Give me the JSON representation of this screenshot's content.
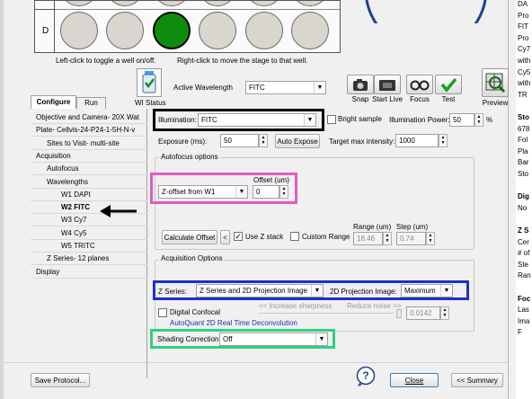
{
  "plate": {
    "row_label": "D"
  },
  "hint": {
    "left": "Left-click to toggle a well on/off.",
    "right": "Right-click to move the stage to that well."
  },
  "toolbar": {
    "wi_status": "WI Status",
    "active_wavelength_label": "Active Wavelength",
    "active_wavelength": "FITC",
    "snap": "Snap",
    "start_live": "Start Live",
    "focus": "Focus",
    "test": "Test",
    "preview": "Preview"
  },
  "tabs": {
    "configure": "Configure",
    "run": "Run"
  },
  "nav": {
    "items": [
      "Objective and Camera- 20X Wat",
      "Plate- Cellvis-24-P24-1-5H-N-v",
      "Sites to Visit- multi-site",
      "Acquisition",
      "Autofocus",
      "Wavelengths",
      "W1 DAPI",
      "W2 FITC",
      "W3 Cy7",
      "W4 Cy5",
      "W5 TRITC",
      "Z Series- 12 planes",
      "Display"
    ]
  },
  "illumination": {
    "label": "Illumination:",
    "value": "FITC",
    "bright_sample": "Bright sample",
    "power_label": "Illumination Power:",
    "power_value": "50",
    "power_unit": "%"
  },
  "exposure": {
    "label": "Exposure (ms):",
    "value": "50",
    "auto_expose": "Auto Expose",
    "target_label": "Target max intensity:",
    "target_value": "1000"
  },
  "autofocus": {
    "group_label": "Autofocus options",
    "offset_header": "Offset (um)",
    "mode": "Z-offset from W1",
    "offset_value": "0",
    "calc_offset": "Calculate Offset",
    "less_btn": "<",
    "use_z_stack": "Use Z stack",
    "custom_range": "Custom Range",
    "range_header": "Range (um)",
    "range_value": "18.46",
    "step_header": "Step (um)",
    "step_value": "0.74"
  },
  "acquisition": {
    "group_label": "Acquisition Options",
    "z_series_label": "Z Series:",
    "z_series_value": "Z Series and 2D Projection Image",
    "projection_label": "2D Projection Image:",
    "projection_value": "Maximum",
    "digital_confocal": "Digital Confocal",
    "increase_sharpness": "<< Increase sharpness",
    "reduce_noise": "Reduce noise >>",
    "sharpness_value": "0.0142",
    "autoquant": "AutoQuant 2D Real Time Deconvolution",
    "shading_label": "Shading Correction",
    "shading_value": "Off"
  },
  "footer": {
    "save_protocol": "Save Protocol...",
    "help_symbol": "?",
    "close": "Close",
    "summary": "<< Summary"
  },
  "right_panel": {
    "lines": [
      "DA",
      "Pro",
      "FIT",
      "Pro",
      "Cy7",
      "with",
      "Cy5",
      "with",
      "TR",
      "",
      "Sto",
      "678",
      "Fol",
      "Pla",
      "Bar",
      "Sto",
      "",
      "Dig",
      "No",
      "",
      "Z S",
      "Cer",
      "# of",
      "Ste",
      "Ran",
      "",
      "Foc",
      "Las",
      "Ima",
      "F"
    ]
  },
  "colors": {
    "pink": "#e05cc0",
    "blue": "#1d2fcf",
    "green": "#2ed17f",
    "selected_well": "#0e8c0e"
  }
}
